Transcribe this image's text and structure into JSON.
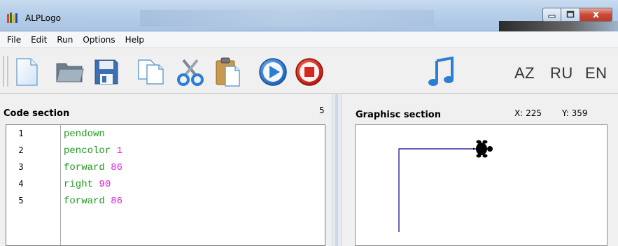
{
  "window": {
    "title": "ALPLogo",
    "close_label": "x"
  },
  "menu": {
    "items": [
      "File",
      "Edit",
      "Run",
      "Options",
      "Help"
    ]
  },
  "toolbar": {
    "languages": [
      "AZ",
      "RU",
      "EN"
    ]
  },
  "code_section": {
    "title": "Code section",
    "line_count": "5",
    "lines": [
      {
        "number": "1",
        "command": "pendown",
        "arg": ""
      },
      {
        "number": "2",
        "command": "pencolor",
        "arg": "1"
      },
      {
        "number": "3",
        "command": "forward",
        "arg": "86"
      },
      {
        "number": "4",
        "command": "right",
        "arg": "90"
      },
      {
        "number": "5",
        "command": "forward",
        "arg": "86"
      }
    ]
  },
  "graphics_section": {
    "title": "Graphisc section",
    "x_readout": "X: 225",
    "y_readout": "Y: 359",
    "pen_color": "#00008b"
  },
  "colors": {
    "keyword": "#1f9b1f",
    "number": "#e020e0",
    "play": "#2a7fd4",
    "stop": "#d8261c",
    "music": "#2a7fd4"
  }
}
